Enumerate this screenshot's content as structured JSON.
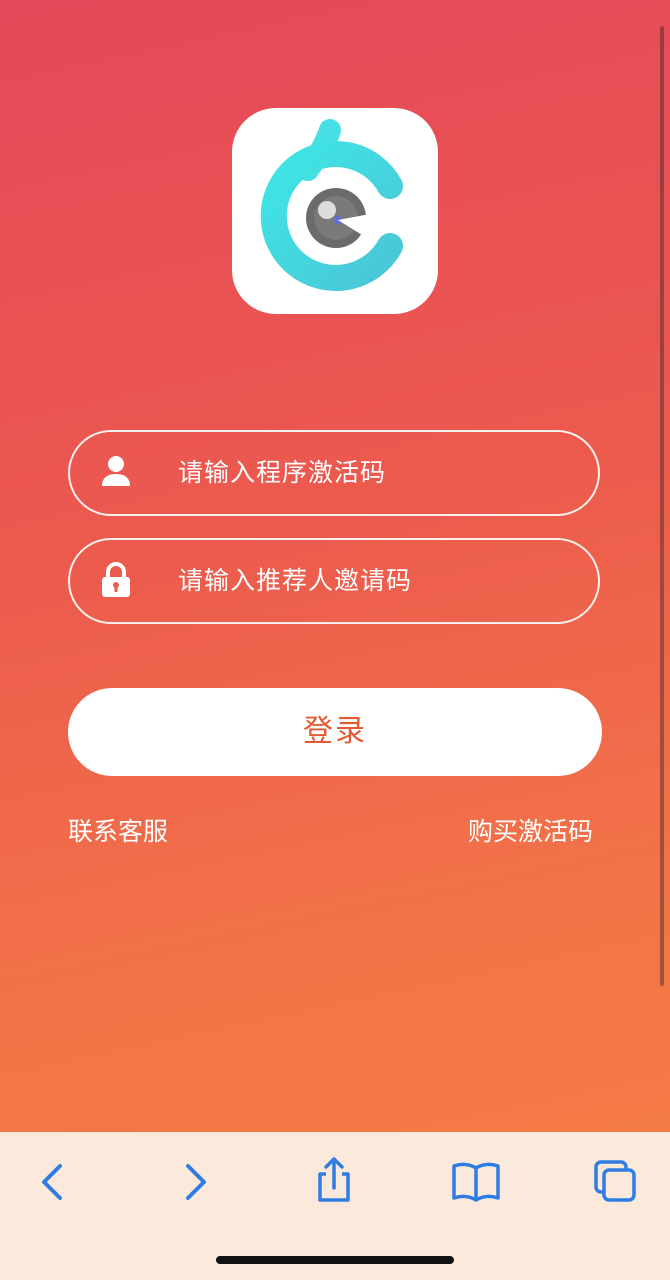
{
  "logo": {
    "icon": "camera-c-logo-icon"
  },
  "form": {
    "activation_code": {
      "placeholder": "请输入程序激活码",
      "icon": "user-icon"
    },
    "referrer_code": {
      "placeholder": "请输入推荐人邀请码",
      "icon": "lock-icon"
    },
    "login_label": "登录"
  },
  "links": {
    "contact_service": "联系客服",
    "buy_activation_code": "购买激活码"
  },
  "toolbar": {
    "items": [
      {
        "icon": "back-icon"
      },
      {
        "icon": "forward-icon"
      },
      {
        "icon": "share-icon"
      },
      {
        "icon": "bookmarks-icon"
      },
      {
        "icon": "tabs-icon"
      }
    ]
  },
  "colors": {
    "gradient_top": "#e4485a",
    "gradient_bottom": "#f47a45",
    "login_text": "#e45a32",
    "toolbar_bg": "#fbeadb",
    "toolbar_icon": "#2f7de1"
  }
}
